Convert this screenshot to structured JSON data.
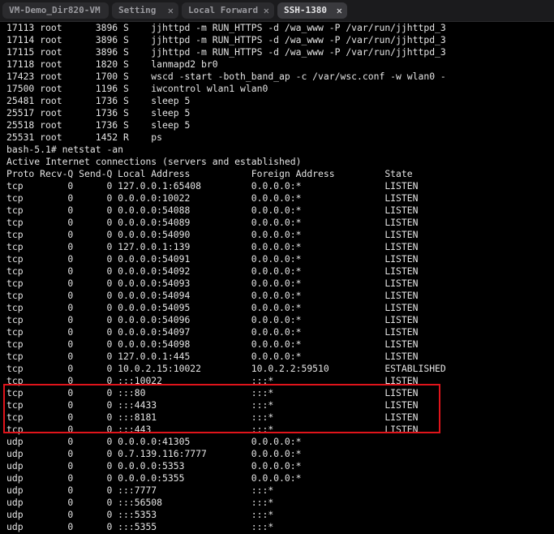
{
  "tabs": [
    {
      "label": "VM-Demo_Dir820-VM",
      "closable": false,
      "active": false
    },
    {
      "label": "Setting",
      "closable": true,
      "active": false
    },
    {
      "label": "Local Forward",
      "closable": true,
      "active": false
    },
    {
      "label": "SSH-1380",
      "closable": true,
      "active": true
    }
  ],
  "icons": {
    "tab_close": "close-icon"
  },
  "colors": {
    "background": "#000000",
    "text": "#e4e4e4",
    "highlight": "#e0141b",
    "tab_active": "#3a3a3e",
    "tab_inactive": "#2b2b2e"
  },
  "terminal": {
    "lines": [
      "17113 root      3896 S    jjhttpd -m RUN_HTTPS -d /wa_www -P /var/run/jjhttpd_3",
      "17114 root      3896 S    jjhttpd -m RUN_HTTPS -d /wa_www -P /var/run/jjhttpd_3",
      "17115 root      3896 S    jjhttpd -m RUN_HTTPS -d /wa_www -P /var/run/jjhttpd_3",
      "17118 root      1820 S    lanmapd2 br0",
      "17423 root      1700 S    wscd -start -both_band_ap -c /var/wsc.conf -w wlan0 -",
      "17500 root      1196 S    iwcontrol wlan1 wlan0",
      "25481 root      1736 S    sleep 5",
      "25517 root      1736 S    sleep 5",
      "25518 root      1736 S    sleep 5",
      "25531 root      1452 R    ps",
      "bash-5.1# netstat -an",
      "Active Internet connections (servers and established)",
      "Proto Recv-Q Send-Q Local Address           Foreign Address         State",
      "tcp        0      0 127.0.0.1:65408         0.0.0.0:*               LISTEN",
      "tcp        0      0 0.0.0.0:10022           0.0.0.0:*               LISTEN",
      "tcp        0      0 0.0.0.0:54088           0.0.0.0:*               LISTEN",
      "tcp        0      0 0.0.0.0:54089           0.0.0.0:*               LISTEN",
      "tcp        0      0 0.0.0.0:54090           0.0.0.0:*               LISTEN",
      "tcp        0      0 127.0.0.1:139           0.0.0.0:*               LISTEN",
      "tcp        0      0 0.0.0.0:54091           0.0.0.0:*               LISTEN",
      "tcp        0      0 0.0.0.0:54092           0.0.0.0:*               LISTEN",
      "tcp        0      0 0.0.0.0:54093           0.0.0.0:*               LISTEN",
      "tcp        0      0 0.0.0.0:54094           0.0.0.0:*               LISTEN",
      "tcp        0      0 0.0.0.0:54095           0.0.0.0:*               LISTEN",
      "tcp        0      0 0.0.0.0:54096           0.0.0.0:*               LISTEN",
      "tcp        0      0 0.0.0.0:54097           0.0.0.0:*               LISTEN",
      "tcp        0      0 0.0.0.0:54098           0.0.0.0:*               LISTEN",
      "tcp        0      0 127.0.0.1:445           0.0.0.0:*               LISTEN",
      "tcp        0      0 10.0.2.15:10022         10.0.2.2:59510          ESTABLISHED",
      "tcp        0      0 :::10022                :::*                    LISTEN",
      "tcp        0      0 :::80                   :::*                    LISTEN",
      "tcp        0      0 :::4433                 :::*                    LISTEN",
      "tcp        0      0 :::8181                 :::*                    LISTEN",
      "tcp        0      0 :::443                  :::*                    LISTEN",
      "udp        0      0 0.0.0.0:41305           0.0.0.0:*",
      "udp        0      0 0.7.139.116:7777        0.0.0.0:*",
      "udp        0      0 0.0.0.0:5353            0.0.0.0:*",
      "udp        0      0 0.0.0.0:5355            0.0.0.0:*",
      "udp        0      0 :::7777                 :::*",
      "udp        0      0 :::56508                :::*",
      "udp        0      0 :::5353                 :::*",
      "udp        0      0 :::5355                 :::*"
    ]
  }
}
